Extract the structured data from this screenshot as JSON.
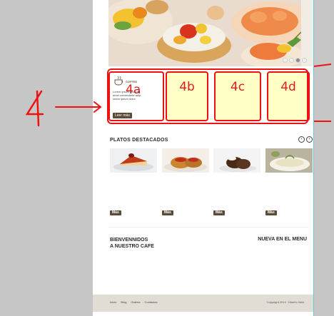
{
  "hero": {
    "slider_dots": 4,
    "active_dot": 3
  },
  "promo": {
    "logo_text": "COFFEE",
    "lines": [
      "Lorem ipsum dolor sit",
      "amet consectetur adip",
      "lorem ipsum dolor"
    ],
    "button_label": "Leer más",
    "boxes": [
      {
        "label": "4a"
      },
      {
        "label": "4b"
      },
      {
        "label": "4c"
      },
      {
        "label": "4d"
      }
    ]
  },
  "featured": {
    "title": "PLATOS DESTACADOS",
    "dishes": [
      {
        "button_label": "Más"
      },
      {
        "button_label": "Más"
      },
      {
        "button_label": "Más"
      },
      {
        "button_label": "Más"
      }
    ]
  },
  "sections": {
    "welcome_line1": "BIENVENNIDOS",
    "welcome_line2": "A NUESTRO CAFE",
    "new_menu": "NUEVA EN EL MENU"
  },
  "footer": {
    "links": [
      "Inicio",
      "Blog",
      "Galería",
      "Contactos"
    ],
    "copyright": "Copyright 2014 · Diseño Web"
  },
  "annotation": {
    "number": "4"
  },
  "colors": {
    "annotation_red": "#ee1111",
    "box_fill": "#ffffc6",
    "button_brown": "#5a4a36",
    "guide_cyan": "#63c9d4"
  }
}
